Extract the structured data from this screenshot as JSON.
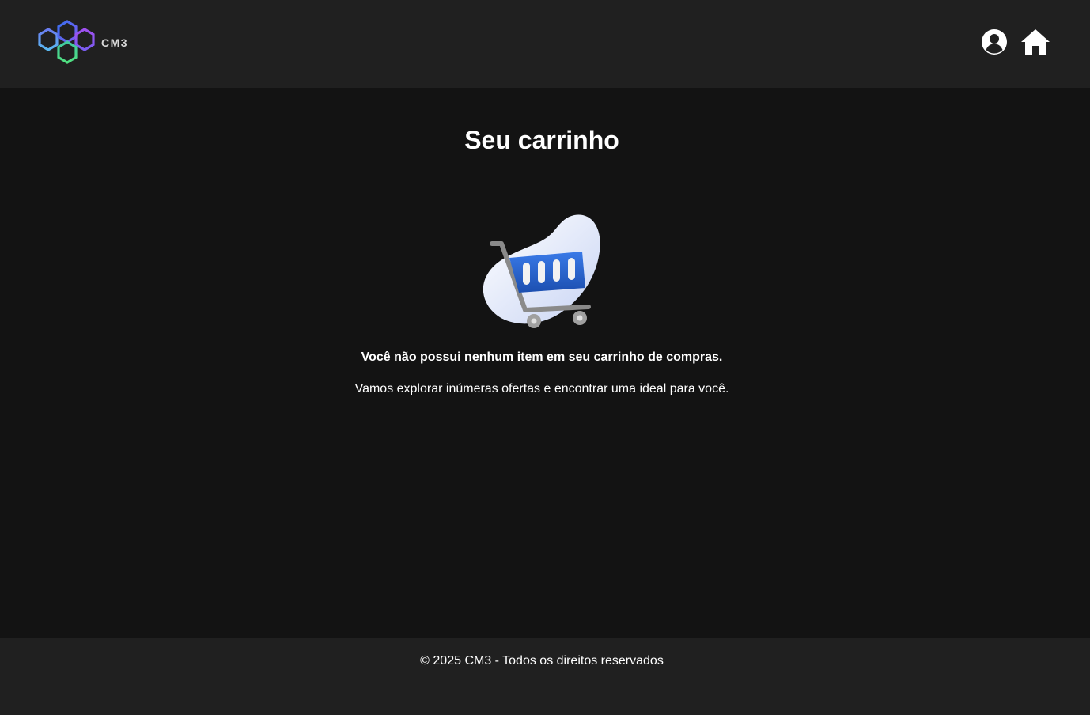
{
  "header": {
    "logo_text": "CM3",
    "logo_icon": "cm3-hexagon-logo-icon",
    "profile_icon": "user-circle-icon",
    "home_icon": "home-icon"
  },
  "main": {
    "title": "Seu carrinho",
    "illustration": "shopping-cart-icon",
    "empty_title": "Você não possui nenhum item em seu carrinho de compras.",
    "empty_subtitle": "Vamos explorar inúmeras ofertas e encontrar uma ideal para você."
  },
  "footer": {
    "copyright": "© 2025 CM3 - Todos os direitos reservados"
  },
  "colors": {
    "header_bg": "#202020",
    "page_bg": "#131313",
    "footer_bg": "#202020",
    "text": "#ffffff",
    "cart_blue": "#2b5fc4"
  }
}
